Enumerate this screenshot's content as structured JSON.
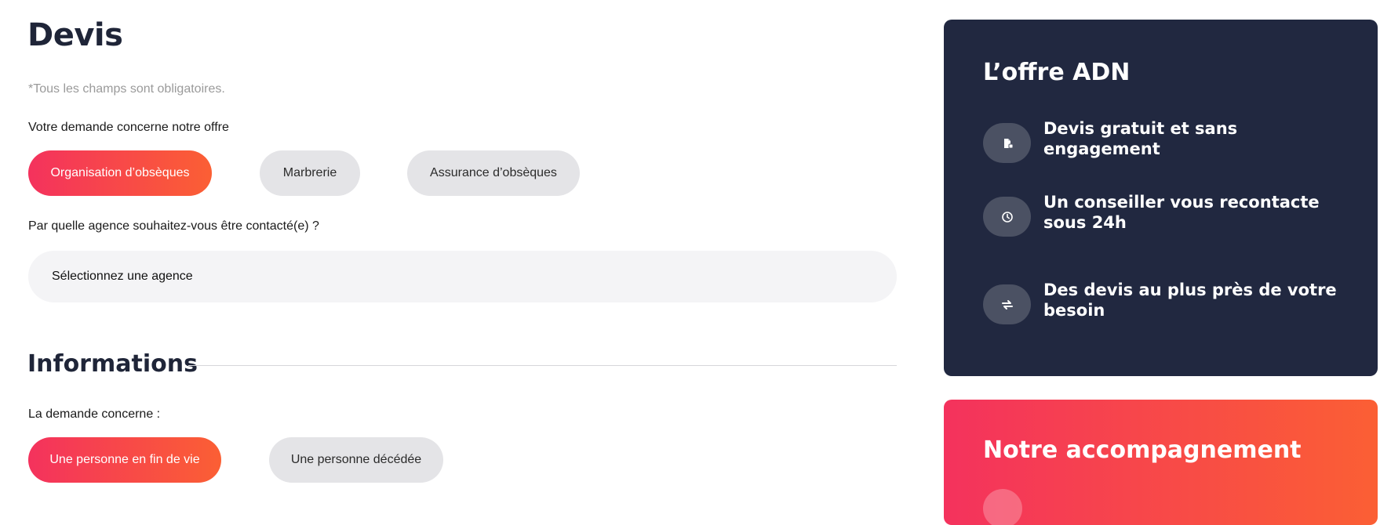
{
  "form": {
    "title": "Devis",
    "required_note": "*Tous les champs sont obligatoires.",
    "offer_question": "Votre demande concerne notre offre",
    "offers": [
      {
        "label": "Organisation d’obsèques",
        "selected": true
      },
      {
        "label": "Marbrerie",
        "selected": false
      },
      {
        "label": "Assurance d’obsèques",
        "selected": false
      }
    ],
    "agency_question": "Par quelle agence souhaitez-vous être contacté(e) ?",
    "agency_select": {
      "value": "Sélectionnez une agence"
    },
    "informations_title": "Informations",
    "concern_question": "La demande concerne :",
    "concern_options": [
      {
        "label": "Une personne en fin de vie",
        "selected": true
      },
      {
        "label": "Une personne décédée",
        "selected": false
      }
    ]
  },
  "sidebar": {
    "offer_card": {
      "title": "L’offre ADN",
      "features": [
        {
          "icon": "document-icon",
          "text": "Devis gratuit et sans engagement"
        },
        {
          "icon": "clock-icon",
          "text": "Un conseiller vous recontacte sous 24h"
        },
        {
          "icon": "exchange-icon",
          "text": "Des devis au plus près de votre besoin"
        }
      ]
    },
    "support_card": {
      "title": "Notre accompagnement"
    }
  },
  "colors": {
    "accent_start": "#f4325d",
    "accent_end": "#fb5f34",
    "dark_navy": "#212840",
    "pill_inactive": "#e4e4e7"
  }
}
